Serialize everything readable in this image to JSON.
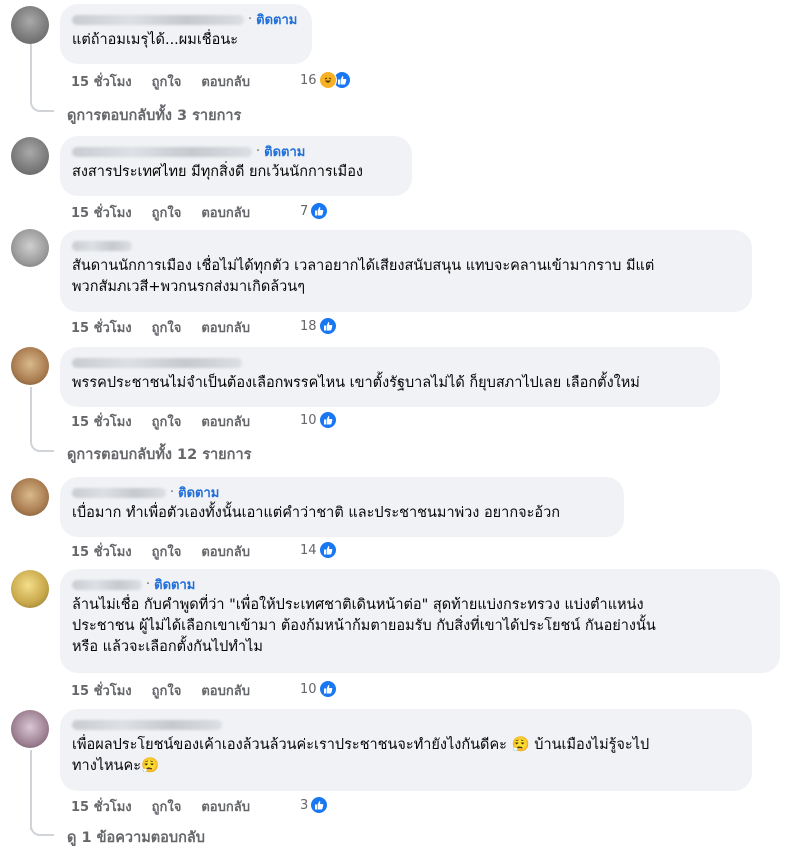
{
  "labels": {
    "time": "15 ชั่วโมง",
    "like": "ถูกใจ",
    "reply": "ตอบกลับ",
    "follow": "ติดตาม",
    "dot": "·"
  },
  "comments": [
    {
      "text1": "แต่ถ้าอมเมรุได้...ผมเชื่อนะ",
      "reactions": "16",
      "replies": "ดูการตอบกลับทั้ง 3 รายการ"
    },
    {
      "text1": "สงสารประเทศไทย มีทุกสิ่งดี ยกเว้นนักการเมือง",
      "reactions": "7"
    },
    {
      "text1": "สันดานนักการเมือง เชื่อไม่ได้ทุกตัว เวลาอยากได้เสียงสนับสนุน แทบจะคลานเข้ามากราบ มีแต่",
      "text2": "พวกสัมภเวสี+พวกนรกส่งมาเกิดล้วนๆ",
      "reactions": "18"
    },
    {
      "text1": "พรรคประชาชนไม่จำเป็นต้องเลือกพรรคไหน เขาตั้งรัฐบาลไม่ได้ ก็ยุบสภาไปเลย เลือกตั้งใหม่",
      "reactions": "10",
      "replies": "ดูการตอบกลับทั้ง 12 รายการ"
    },
    {
      "text1": "เบื่อมาก ทำเพื่อตัวเองทั้งนั้นเอาแต่คำว่าชาติ และประชาชนมาพ่วง อยากจะอ้วก",
      "reactions": "14"
    },
    {
      "text1": "ล้านไม่เชื่อ กับคำพูดที่ว่า \"เพื่อให้ประเทศชาติเดินหน้าต่อ\" สุดท้ายแบ่งกระทรวง แบ่งตำแหน่ง",
      "text2": "ประชาชน ผู้ไม่ได้เลือกเขาเข้ามา ต้องก้มหน้าก้มตายอมรับ กับสิ่งที่เขาได้ประโยชน์ กันอย่างนั้น",
      "text3": "หรือ แล้วจะเลือกตั้งกันไปทำไม",
      "reactions": "10"
    },
    {
      "text1": "เพื่อผลประโยชน์ของเค้าเองล้วนล้วนค่ะเราประชาชนจะทำยังไงกันดีคะ 😮‍💨 บ้านเมืองไม่รู้จะไป",
      "text2": "ทางไหนคะ😮‍💨",
      "reactions": "3",
      "replies": "ดู 1 ข้อความตอบกลับ"
    }
  ]
}
